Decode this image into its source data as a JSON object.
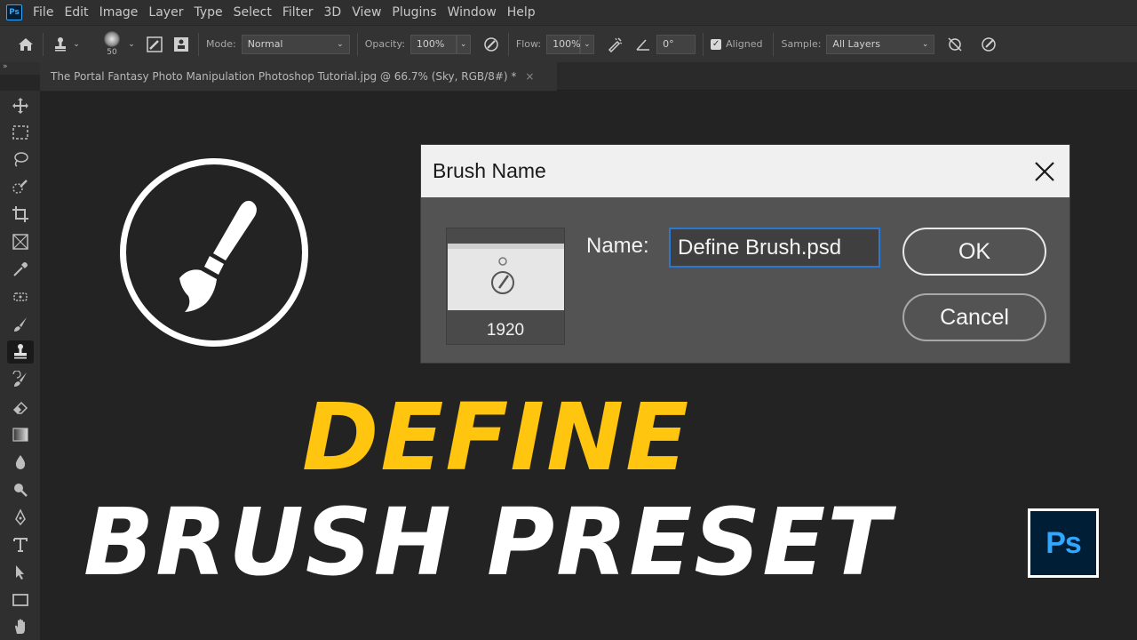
{
  "app": {
    "logo": "Ps",
    "menu": [
      "File",
      "Edit",
      "Image",
      "Layer",
      "Type",
      "Select",
      "Filter",
      "3D",
      "View",
      "Plugins",
      "Window",
      "Help"
    ]
  },
  "options_bar": {
    "brush_size": "50",
    "mode_label": "Mode:",
    "mode_value": "Normal",
    "opacity_label": "Opacity:",
    "opacity_value": "100%",
    "flow_label": "Flow:",
    "flow_value": "100%",
    "angle_value": "0°",
    "aligned_label": "Aligned",
    "aligned_checked": true,
    "sample_label": "Sample:",
    "sample_value": "All Layers"
  },
  "toolbar": {
    "collapse": "»",
    "tools": [
      "move-tool",
      "marquee-tool",
      "lasso-tool",
      "quick-selection-tool",
      "crop-tool",
      "frame-tool",
      "eyedropper-tool",
      "healing-brush-tool",
      "brush-tool",
      "clone-stamp-tool",
      "history-brush-tool",
      "eraser-tool",
      "gradient-tool",
      "blur-tool",
      "dodge-tool",
      "pen-tool",
      "type-tool",
      "path-selection-tool",
      "rectangle-tool",
      "hand-tool"
    ],
    "active_tool": "clone-stamp-tool"
  },
  "document_tab": {
    "title": "The Portal Fantasy Photo Manipulation Photoshop Tutorial.jpg @ 66.7% (Sky, RGB/8#) *",
    "close": "×"
  },
  "dialog": {
    "title": "Brush Name",
    "close": "✕",
    "thumbnail_size": "1920",
    "name_label": "Name:",
    "name_value": "Define Brush.psd",
    "ok_label": "OK",
    "cancel_label": "Cancel"
  },
  "headline": {
    "line1": "DEFINE",
    "line2": "BRUSH PRESET",
    "line1_color": "#ffc50f",
    "line2_color": "#ffffff"
  },
  "badge": {
    "text": "Ps",
    "text_color": "#31a8ff",
    "bg_color": "#001e36"
  }
}
